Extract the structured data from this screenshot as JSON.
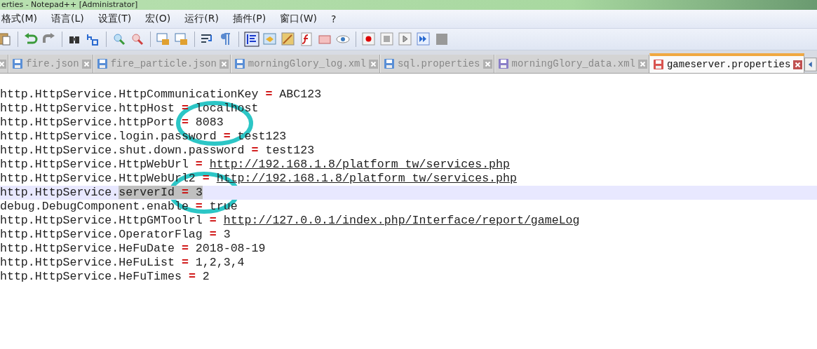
{
  "window": {
    "title": "erties - Notepad++ [Administrator]"
  },
  "menu": [
    "格式(M)",
    "语言(L)",
    "设置(T)",
    "宏(O)",
    "运行(R)",
    "插件(P)",
    "窗口(W)",
    "?"
  ],
  "tabs": [
    {
      "selected": false
    },
    {
      "label": "fire.json",
      "selected": false,
      "color": "#5a8fd6"
    },
    {
      "label": "fire_particle.json",
      "selected": false,
      "color": "#5a8fd6"
    },
    {
      "label": "morningGlory_log.xml",
      "selected": false,
      "color": "#5a8fd6"
    },
    {
      "label": "sql.properties",
      "selected": false,
      "color": "#5a8fd6"
    },
    {
      "label": "morningGlory_data.xml",
      "selected": false,
      "color": "#8a7fc8"
    },
    {
      "label": "gameserver.properties",
      "selected": true,
      "color": "#d9534f"
    }
  ],
  "editor": {
    "lines": [
      {
        "key": "http.HttpService.HttpCommunicationKey",
        "value": "ABC123",
        "link": false,
        "current": false,
        "selected": false
      },
      {
        "key": "http.HttpService.httpHost",
        "value": "localhost",
        "link": false,
        "current": false,
        "selected": false
      },
      {
        "key": "http.HttpService.httpPort",
        "value": "8083",
        "link": false,
        "current": false,
        "selected": false
      },
      {
        "key": "http.HttpService.login.password",
        "value": "test123",
        "link": false,
        "current": false,
        "selected": false
      },
      {
        "key": "http.HttpService.shut.down.password",
        "value": "test123",
        "link": false,
        "current": false,
        "selected": false
      },
      {
        "key": "http.HttpService.HttpWebUrl",
        "value": "http://192.168.1.8/platform_tw/services.php",
        "link": true,
        "current": false,
        "selected": false
      },
      {
        "key": "http.HttpService.HttpWebUrl2",
        "value": "http://192.168.1.8/platform_tw/services.php",
        "link": true,
        "current": false,
        "selected": false
      },
      {
        "key": "http.HttpService.serverId",
        "value": "3",
        "link": false,
        "current": true,
        "selected": true
      },
      {
        "key": "debug.DebugComponent.enable",
        "value": "true",
        "link": false,
        "current": false,
        "selected": false
      },
      {
        "key": "http.HttpService.HttpGMToolrl",
        "value": "http://127.0.0.1/index.php/Interface/report/gameLog",
        "link": true,
        "current": false,
        "selected": false
      },
      {
        "key": "http.HttpService.OperatorFlag",
        "value": "3",
        "link": false,
        "current": false,
        "selected": false
      },
      {
        "key": "http.HttpService.HeFuDate",
        "value": "2018-08-19",
        "link": false,
        "current": false,
        "selected": false
      },
      {
        "key": "http.HttpService.HeFuList",
        "value": "1,2,3,4",
        "link": false,
        "current": false,
        "selected": false
      },
      {
        "key": "http.HttpService.HeFuTimes",
        "value": "2",
        "link": false,
        "current": false,
        "selected": false
      }
    ],
    "operator": "="
  }
}
